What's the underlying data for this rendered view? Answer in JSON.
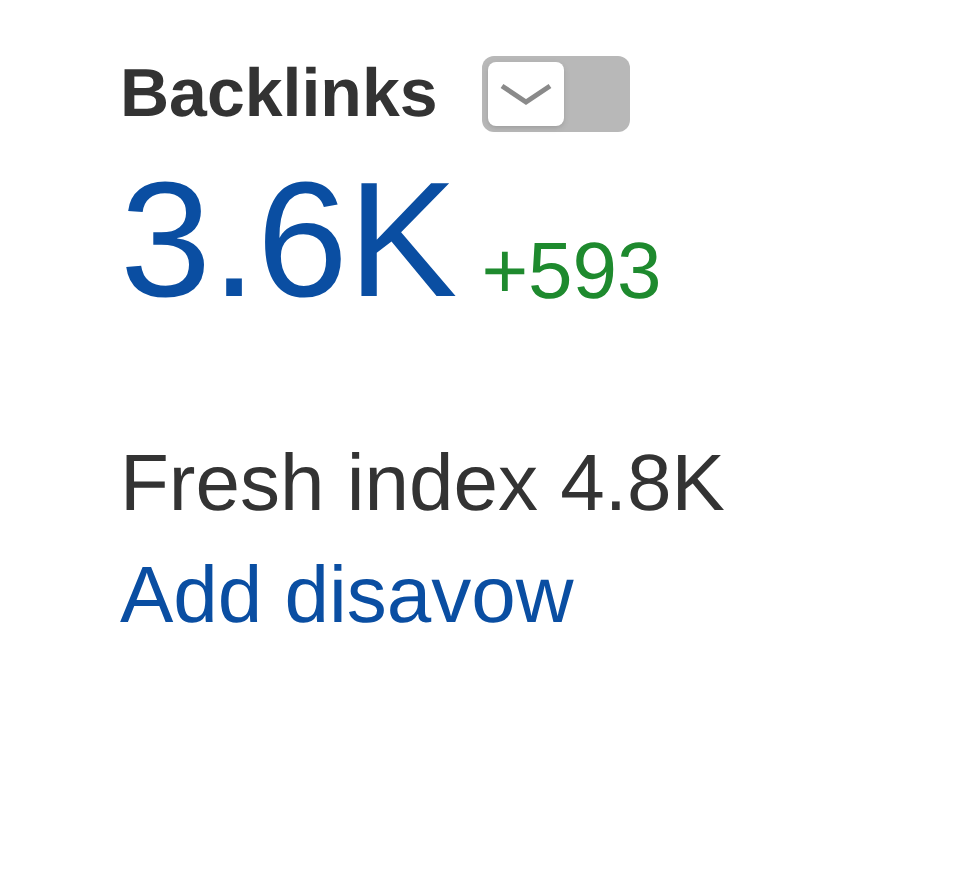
{
  "title": "Backlinks",
  "email_toggle": {
    "on": false
  },
  "value": "3.6K",
  "change": "+593",
  "fresh_index": "Fresh index 4.8K",
  "link": "Add disavow"
}
